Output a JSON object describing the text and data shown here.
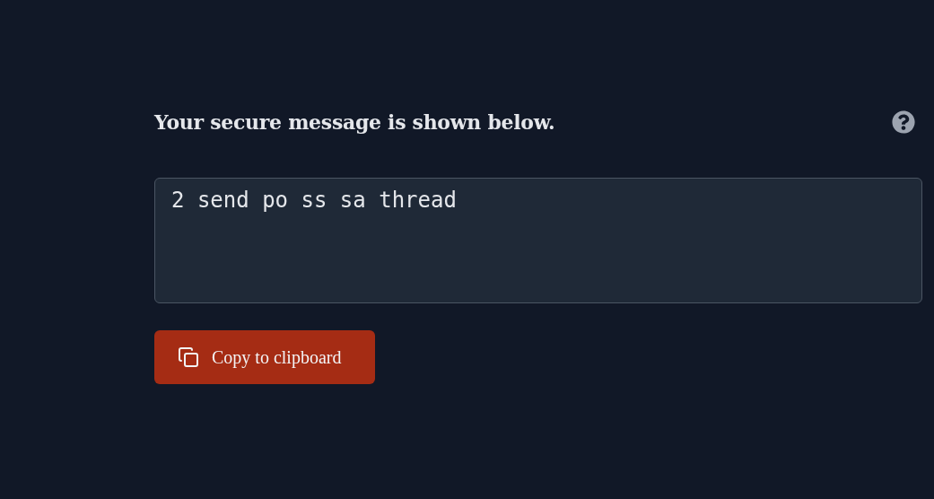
{
  "heading": "Your secure message is shown below.",
  "message": {
    "value": "2 send po ss sa thread"
  },
  "buttons": [
    {
      "kind": "copy",
      "label": "Copy to clipboard"
    }
  ]
}
